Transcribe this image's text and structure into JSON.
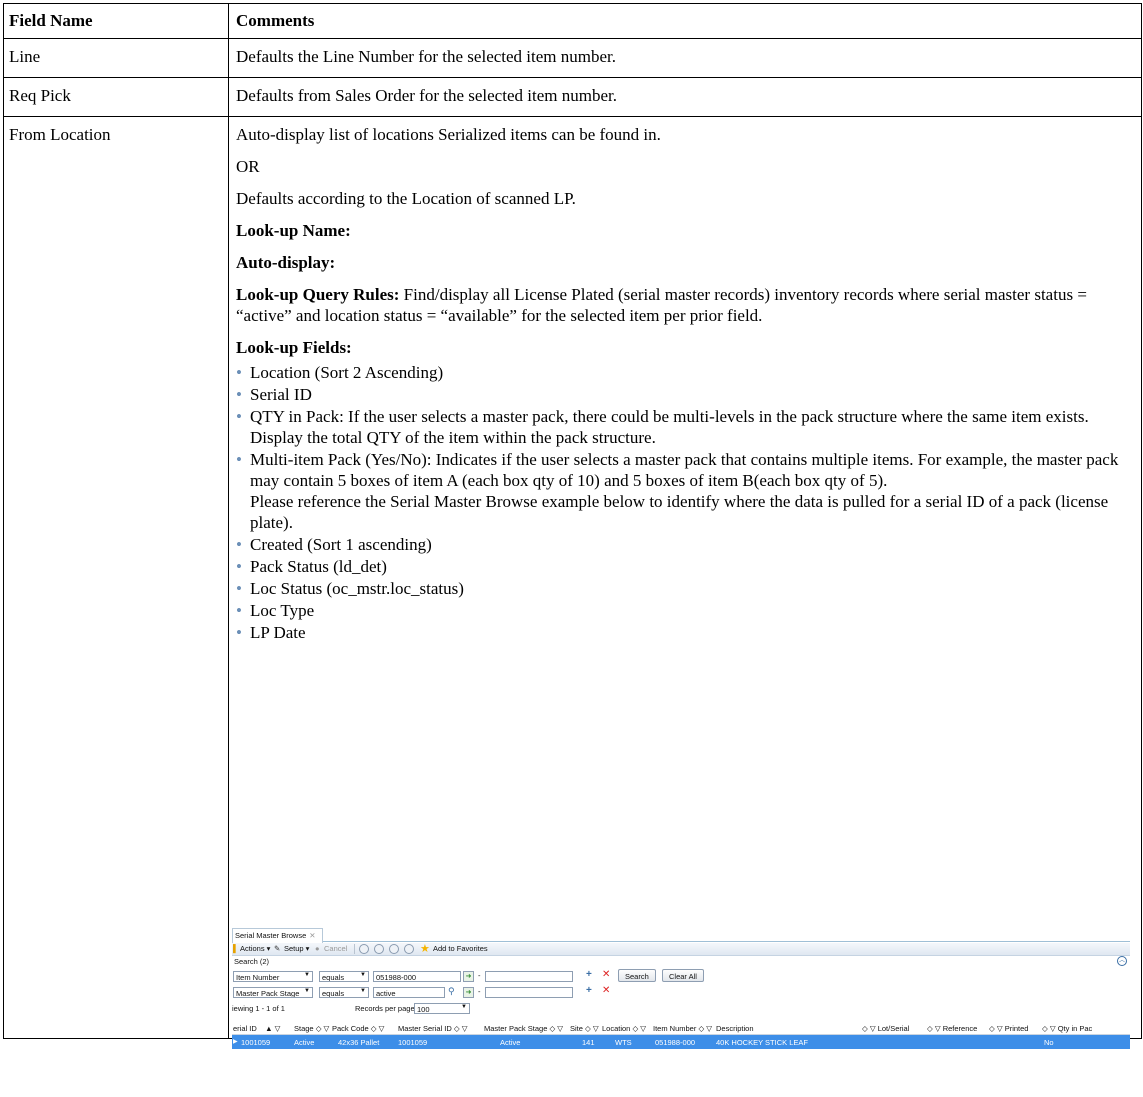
{
  "table": {
    "headers": [
      "Field Name",
      "Comments"
    ],
    "rows": [
      {
        "field": "Line",
        "comment": "Defaults the Line Number for the selected item number."
      },
      {
        "field": "Req Pick",
        "comment": "Defaults from Sales Order for the selected item number."
      },
      {
        "field": "From Location"
      }
    ]
  },
  "from_location": {
    "para1": "Auto-display list of locations Serialized items can be found in.",
    "or": "OR",
    "para2": "Defaults according to the Location of scanned LP.",
    "lookup_name_label": "Look-up Name:",
    "auto_display_label": "Auto-display:",
    "query_rules_label": "Look-up Query Rules:",
    "query_rules_text": " Find/display all License Plated (serial master records) inventory records where serial master status = “active” and location status = “available” for the selected item per prior field.",
    "fields_label": "Look-up Fields:",
    "fields": [
      "Location (Sort 2 Ascending)",
      "Serial ID",
      "QTY in Pack: If the user selects a master pack, there could be multi-levels in the pack structure where the same item exists. Display the total QTY of the item within the pack structure.",
      "Multi-item Pack (Yes/No): Indicates if the user selects a master pack that contains multiple items. For example, the master pack may contain 5 boxes of item A (each box qty of 10) and 5 boxes of item B(each box qty of 5).",
      "Created (Sort 1 ascending)",
      "Pack Status (ld_det)",
      "Loc Status (oc_mstr.loc_status)",
      "Loc Type",
      "LP Date"
    ],
    "multi_item_note": "Please reference the Serial Master Browse example below to identify where the data is pulled for a serial ID of a pack (license plate)."
  },
  "screenshot": {
    "tab": "Serial Master Browse",
    "toolbar": {
      "actions": "Actions ▾",
      "setup": "Setup ▾",
      "cancel": "Cancel",
      "favorites": "Add to Favorites"
    },
    "search_title": "Search (2)",
    "criteria": [
      {
        "field": "Item Number",
        "op": "equals",
        "value": "051988-000"
      },
      {
        "field": "Master Pack Stage",
        "op": "equals",
        "value": "active"
      }
    ],
    "search_btn": "Search",
    "clear_btn": "Clear All",
    "viewing": "iewing  1 - 1  of  1",
    "records_per_page_label": "Records per page:",
    "records_per_page": "100",
    "columns": [
      "erial ID",
      "Stage",
      "Pack Code",
      "Master Serial ID",
      "Master Pack Stage",
      "Site",
      "Location",
      "Item Number",
      "Description",
      "Lot/Serial",
      "Reference",
      "Printed",
      "Qty in Pac"
    ],
    "row": {
      "serial_id": "1001059",
      "stage": "Active",
      "pack_code": "42x36 Pallet",
      "master_serial_id": "1001059",
      "master_pack_stage": "Active",
      "site": "141",
      "location": "WTS",
      "item_number": "051988-000",
      "description": "40K HOCKEY STICK LEAF",
      "printed": "No"
    },
    "colors": {
      "selected_row": "#3d8ee8",
      "bullet": "#6b8fb7"
    }
  }
}
